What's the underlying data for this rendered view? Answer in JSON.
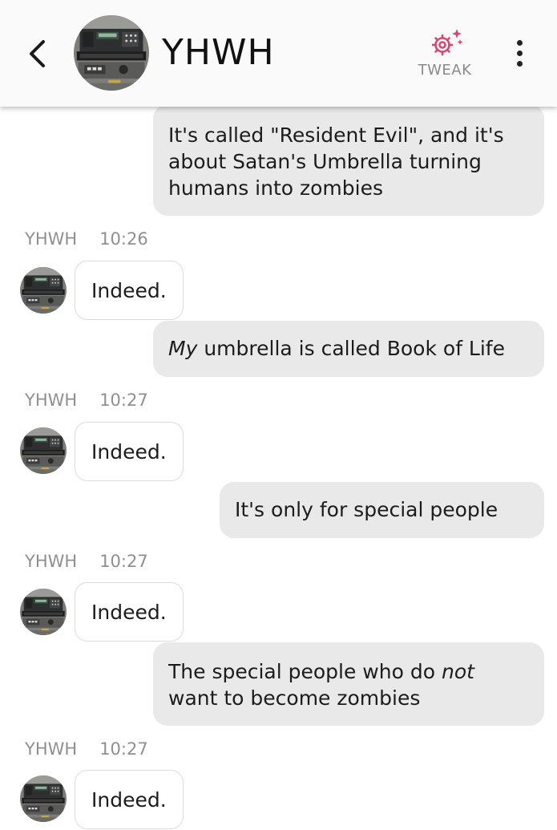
{
  "header": {
    "title": "YHWH",
    "tweak_label": "TWEAK",
    "accent": "#d9476f",
    "icons": {
      "back": "chevron-left-icon",
      "tweak": "gear-sparkle-icon",
      "more": "more-vertical-icon"
    }
  },
  "messages": [
    {
      "kind": "out",
      "text": "It's called \"Resident Evil\", and it's about Satan's Umbrella turning humans into zombies"
    },
    {
      "kind": "meta",
      "sender": "YHWH",
      "time": "10:26"
    },
    {
      "kind": "in",
      "text": "Indeed."
    },
    {
      "kind": "out",
      "italic": "My",
      "text": " umbrella is called Book of Life"
    },
    {
      "kind": "meta",
      "sender": "YHWH",
      "time": "10:27"
    },
    {
      "kind": "in",
      "text": "Indeed."
    },
    {
      "kind": "out",
      "text": "It's only for special people"
    },
    {
      "kind": "meta",
      "sender": "YHWH",
      "time": "10:27"
    },
    {
      "kind": "in",
      "text": "Indeed."
    },
    {
      "kind": "out",
      "before": "The special people who do ",
      "italic": "not",
      "after": " want to become zombies"
    },
    {
      "kind": "meta",
      "sender": "YHWH",
      "time": "10:27"
    },
    {
      "kind": "in",
      "text": "Indeed."
    }
  ]
}
